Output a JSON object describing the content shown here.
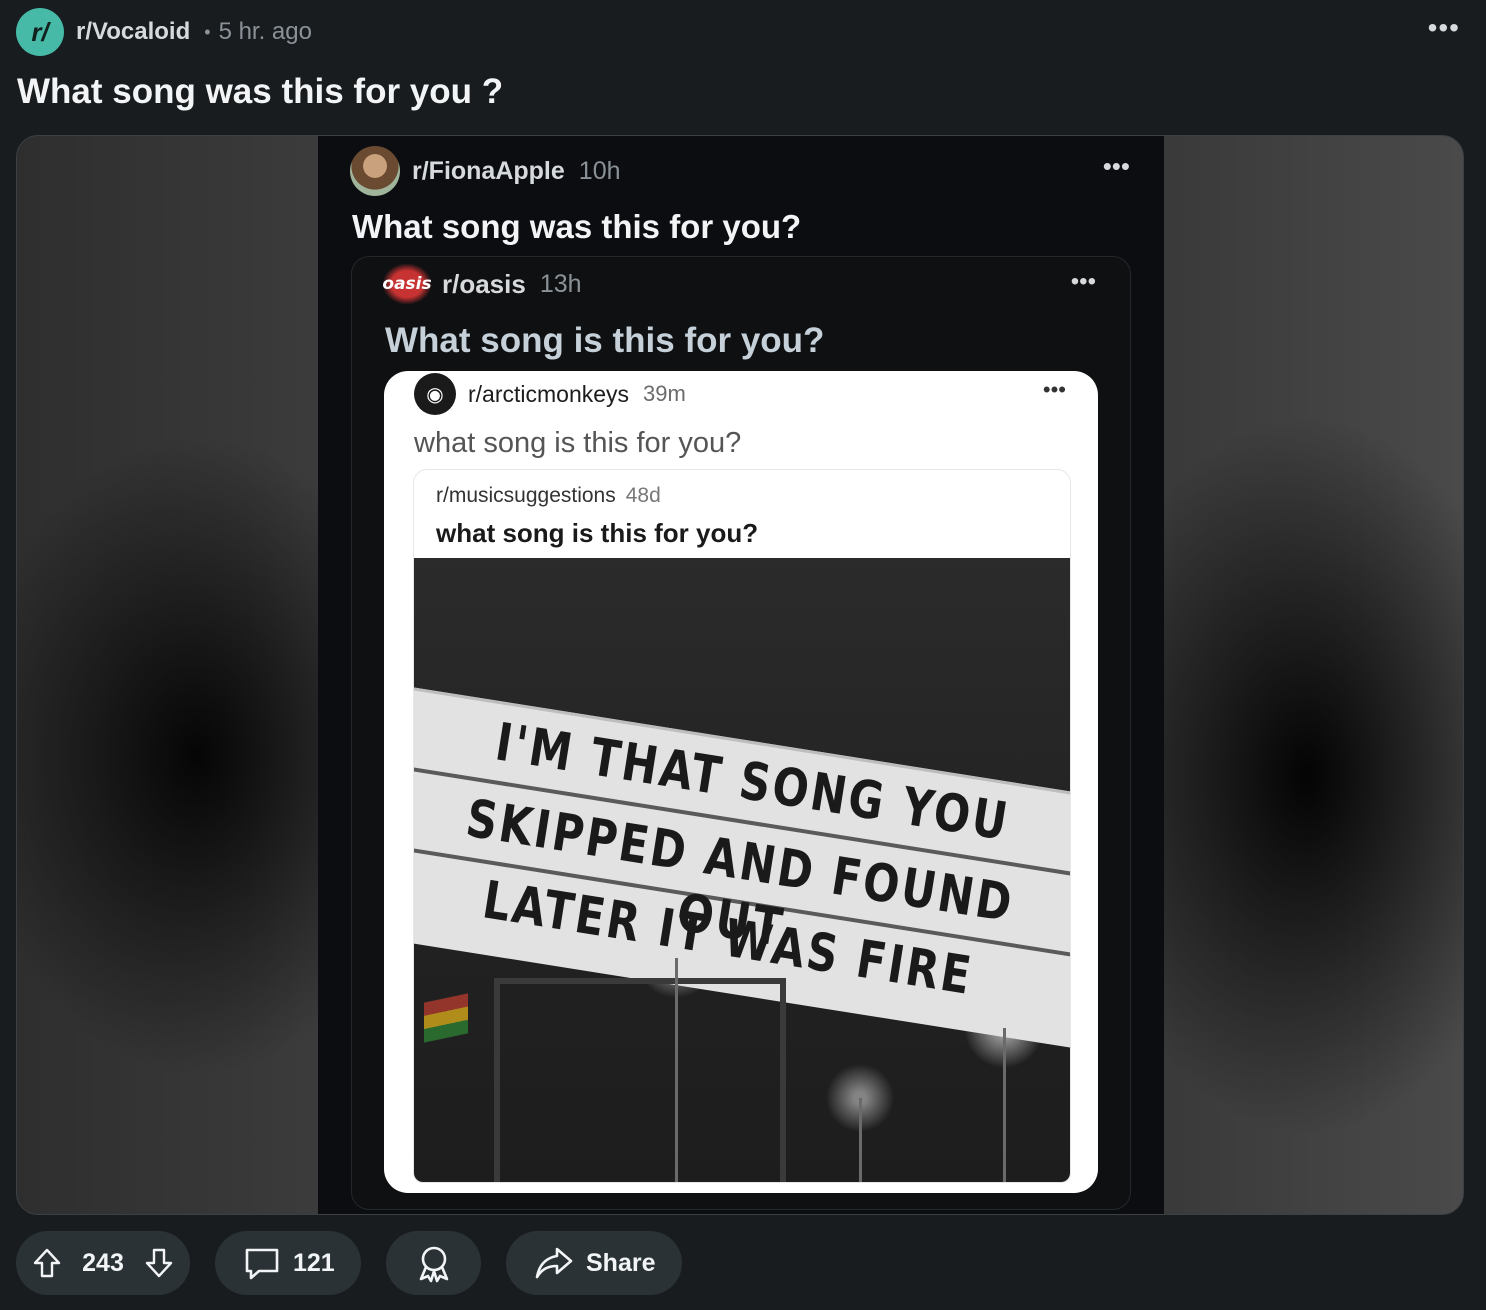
{
  "header": {
    "subreddit": "r/Vocaloid",
    "avatar_text": "r/",
    "separator": "•",
    "time": "5 hr. ago",
    "more": "•••"
  },
  "post": {
    "title": "What song was this for you ?"
  },
  "embedded": {
    "fiona": {
      "subreddit": "r/FionaApple",
      "time": "10h",
      "title": "What song was this for you?",
      "more": "•••"
    },
    "oasis": {
      "logo_text": "oasis",
      "subreddit": "r/oasis",
      "time": "13h",
      "title": "What song is this for you?",
      "more": "•••"
    },
    "arctic": {
      "subreddit": "r/arcticmonkeys",
      "time": "39m",
      "title": "what song is this for you?",
      "more": "•••"
    },
    "musicsuggestions": {
      "subreddit": "r/musicsuggestions",
      "time": "48d",
      "title": "what song is this for you?"
    },
    "sign": {
      "line1": "I'M THAT SONG YOU",
      "line2": "SKIPPED AND FOUND OUT",
      "line3": "LATER IT WAS FIRE"
    }
  },
  "actions": {
    "upvotes": "243",
    "comments": "121",
    "share_label": "Share"
  },
  "colors": {
    "background": "#181c1f",
    "pill": "#2a3236",
    "subreddit_avatar": "#46b9a7"
  },
  "icons": [
    "upvote-icon",
    "downvote-icon",
    "comment-icon",
    "award-icon",
    "share-icon",
    "overflow-menu-icon"
  ]
}
